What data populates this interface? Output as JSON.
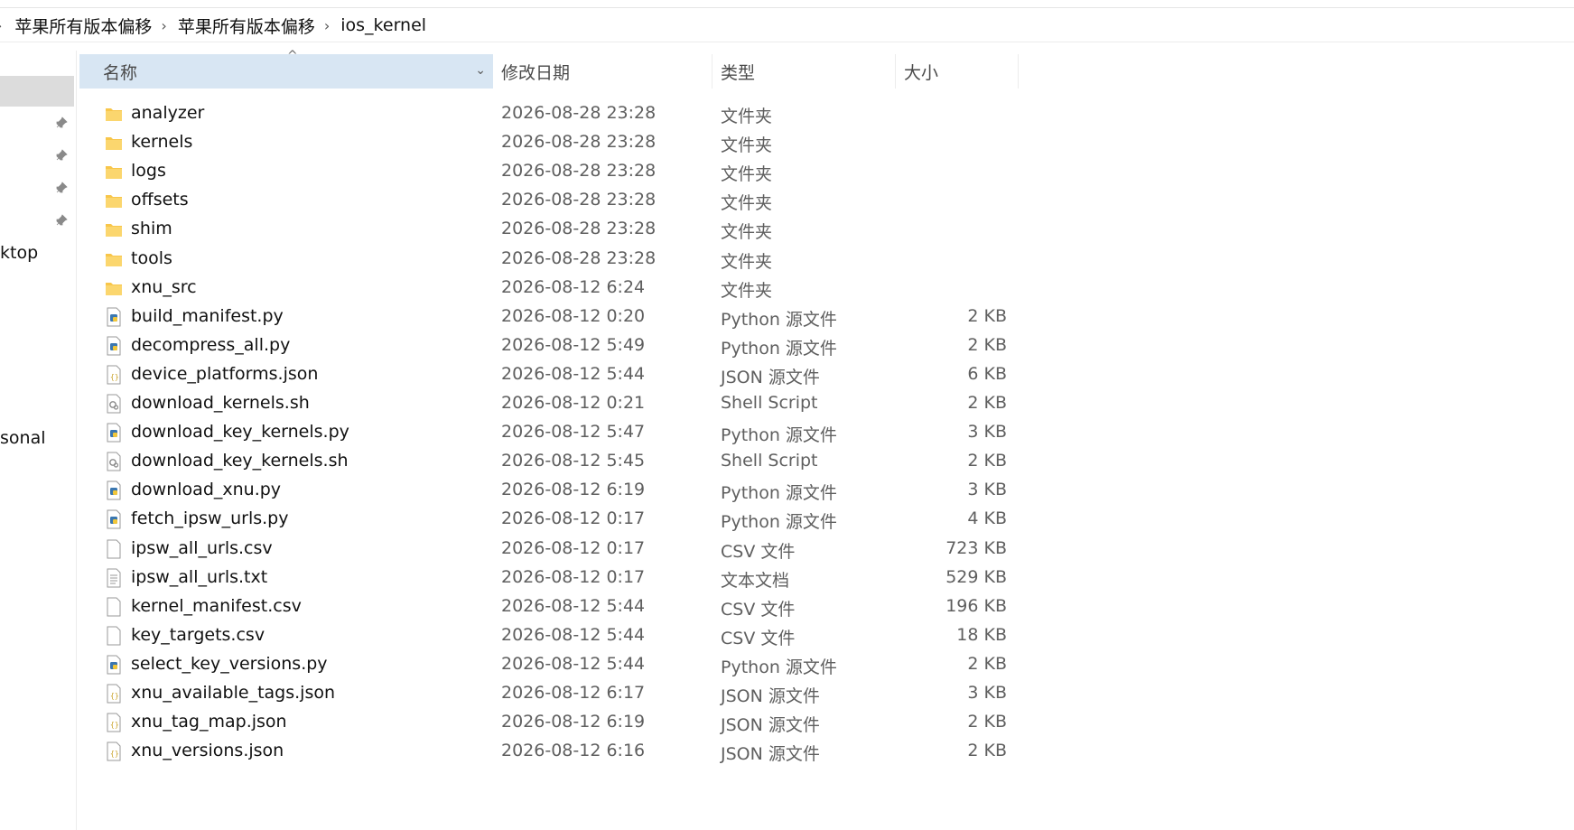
{
  "breadcrumb": {
    "items": [
      "苹果所有版本偏移",
      "苹果所有版本偏移",
      "ios_kernel"
    ]
  },
  "sidebar": {
    "labels": [
      "ktop",
      "sonal"
    ],
    "pin_icon": "pin-icon"
  },
  "columns": {
    "name": "名称",
    "date": "修改日期",
    "type": "类型",
    "size": "大小"
  },
  "files": [
    {
      "name": "analyzer",
      "date": "2026-08-28 23:28",
      "type": "文件夹",
      "size": "",
      "icon": "folder-icon"
    },
    {
      "name": "kernels",
      "date": "2026-08-28 23:28",
      "type": "文件夹",
      "size": "",
      "icon": "folder-icon"
    },
    {
      "name": "logs",
      "date": "2026-08-28 23:28",
      "type": "文件夹",
      "size": "",
      "icon": "folder-icon"
    },
    {
      "name": "offsets",
      "date": "2026-08-28 23:28",
      "type": "文件夹",
      "size": "",
      "icon": "folder-icon"
    },
    {
      "name": "shim",
      "date": "2026-08-28 23:28",
      "type": "文件夹",
      "size": "",
      "icon": "folder-icon"
    },
    {
      "name": "tools",
      "date": "2026-08-28 23:28",
      "type": "文件夹",
      "size": "",
      "icon": "folder-icon"
    },
    {
      "name": "xnu_src",
      "date": "2026-08-12 6:24",
      "type": "文件夹",
      "size": "",
      "icon": "folder-icon"
    },
    {
      "name": "build_manifest.py",
      "date": "2026-08-12 0:20",
      "type": "Python 源文件",
      "size": "2 KB",
      "icon": "python-file-icon"
    },
    {
      "name": "decompress_all.py",
      "date": "2026-08-12 5:49",
      "type": "Python 源文件",
      "size": "2 KB",
      "icon": "python-file-icon"
    },
    {
      "name": "device_platforms.json",
      "date": "2026-08-12 5:44",
      "type": "JSON 源文件",
      "size": "6 KB",
      "icon": "json-file-icon"
    },
    {
      "name": "download_kernels.sh",
      "date": "2026-08-12 0:21",
      "type": "Shell Script",
      "size": "2 KB",
      "icon": "shell-script-icon"
    },
    {
      "name": "download_key_kernels.py",
      "date": "2026-08-12 5:47",
      "type": "Python 源文件",
      "size": "3 KB",
      "icon": "python-file-icon"
    },
    {
      "name": "download_key_kernels.sh",
      "date": "2026-08-12 5:45",
      "type": "Shell Script",
      "size": "2 KB",
      "icon": "shell-script-icon"
    },
    {
      "name": "download_xnu.py",
      "date": "2026-08-12 6:19",
      "type": "Python 源文件",
      "size": "3 KB",
      "icon": "python-file-icon"
    },
    {
      "name": "fetch_ipsw_urls.py",
      "date": "2026-08-12 0:17",
      "type": "Python 源文件",
      "size": "4 KB",
      "icon": "python-file-icon"
    },
    {
      "name": "ipsw_all_urls.csv",
      "date": "2026-08-12 0:17",
      "type": "CSV 文件",
      "size": "723 KB",
      "icon": "csv-file-icon"
    },
    {
      "name": "ipsw_all_urls.txt",
      "date": "2026-08-12 0:17",
      "type": "文本文档",
      "size": "529 KB",
      "icon": "text-file-icon"
    },
    {
      "name": "kernel_manifest.csv",
      "date": "2026-08-12 5:44",
      "type": "CSV 文件",
      "size": "196 KB",
      "icon": "csv-file-icon"
    },
    {
      "name": "key_targets.csv",
      "date": "2026-08-12 5:44",
      "type": "CSV 文件",
      "size": "18 KB",
      "icon": "csv-file-icon"
    },
    {
      "name": "select_key_versions.py",
      "date": "2026-08-12 5:44",
      "type": "Python 源文件",
      "size": "2 KB",
      "icon": "python-file-icon"
    },
    {
      "name": "xnu_available_tags.json",
      "date": "2026-08-12 6:17",
      "type": "JSON 源文件",
      "size": "3 KB",
      "icon": "json-file-icon"
    },
    {
      "name": "xnu_tag_map.json",
      "date": "2026-08-12 6:19",
      "type": "JSON 源文件",
      "size": "2 KB",
      "icon": "json-file-icon"
    },
    {
      "name": "xnu_versions.json",
      "date": "2026-08-12 6:16",
      "type": "JSON 源文件",
      "size": "2 KB",
      "icon": "json-file-icon"
    }
  ],
  "colors": {
    "header_selected": "#d8e6f3",
    "folder_yellow": "#f8c64a",
    "python_blue": "#3b77b0",
    "json_yellow": "#c9a227"
  }
}
